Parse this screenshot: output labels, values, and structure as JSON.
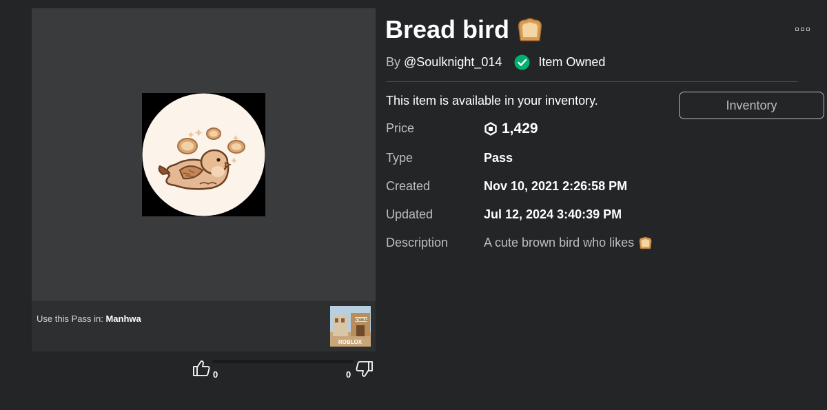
{
  "item": {
    "title": "Bread bird",
    "title_icon": "bread-emoji",
    "by_label": "By",
    "creator": "@Soulknight_014",
    "owned_label": "Item Owned",
    "availability": "This item is available in your inventory.",
    "inventory_button": "Inventory"
  },
  "details": {
    "price_label": "Price",
    "price_value": "1,429",
    "type_label": "Type",
    "type_value": "Pass",
    "created_label": "Created",
    "created_value": "Nov 10, 2021 2:26:58 PM",
    "updated_label": "Updated",
    "updated_value": "Jul 12, 2024 3:40:39 PM",
    "description_label": "Description",
    "description_value": "A cute brown bird who likes"
  },
  "usage": {
    "prefix": "Use this Pass in:",
    "game_name": "Manhwa"
  },
  "votes": {
    "up_count": "0",
    "down_count": "0"
  },
  "colors": {
    "background": "#232527",
    "panel": "#393b3d",
    "owned_green": "#00b06f",
    "muted_text": "#bdbebe"
  },
  "icons": [
    "bread-emoji",
    "more-options-icon",
    "check-circle-icon",
    "robux-icon",
    "thumbs-up-icon",
    "thumbs-down-icon"
  ]
}
